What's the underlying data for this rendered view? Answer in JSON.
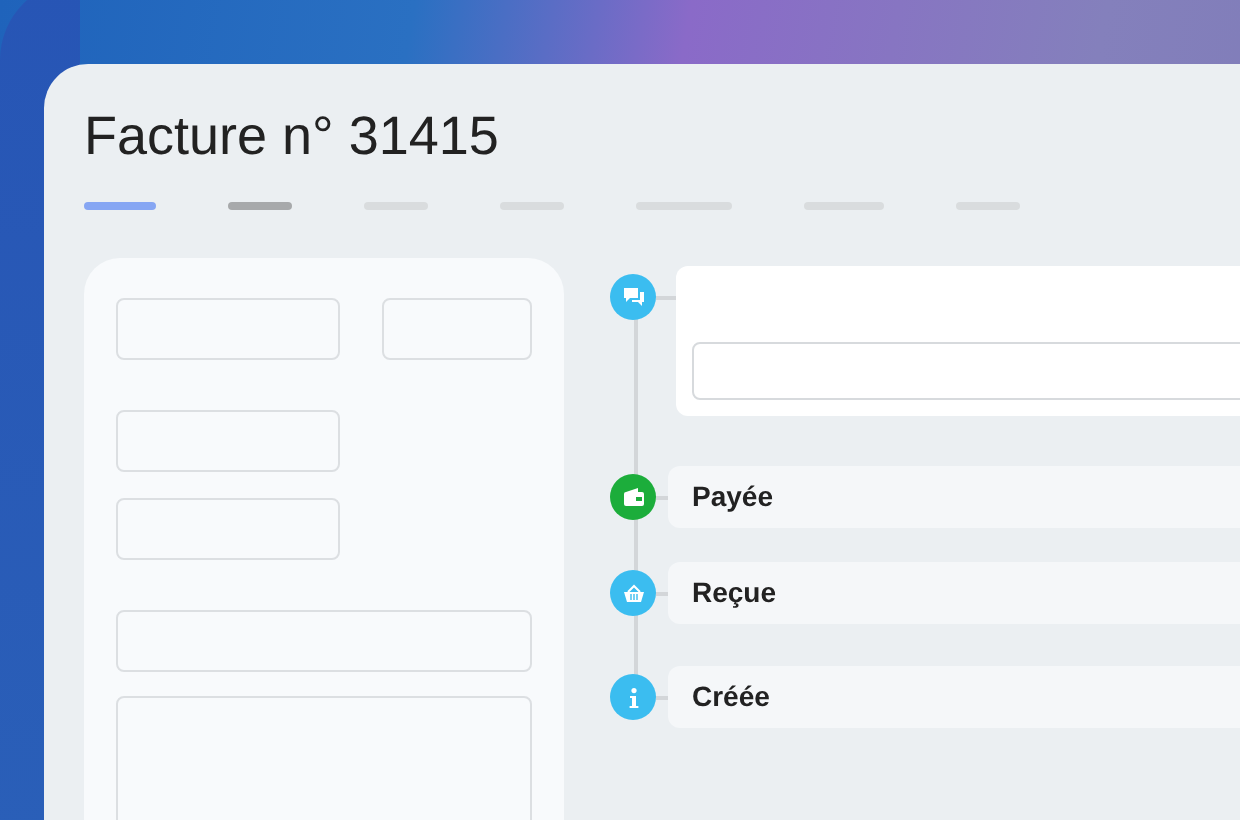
{
  "title": "Facture n° 31415",
  "tabs": [
    {
      "selected": true
    },
    {
      "selected": false,
      "visited": true
    },
    {
      "selected": false
    },
    {
      "selected": false
    },
    {
      "selected": false
    },
    {
      "selected": false
    },
    {
      "selected": false
    }
  ],
  "timeline": [
    {
      "kind": "comment",
      "color": "#3bbdf0"
    },
    {
      "kind": "status",
      "label": "Payée",
      "color": "#1cad3b"
    },
    {
      "kind": "status",
      "label": "Reçue",
      "color": "#3bbdf0"
    },
    {
      "kind": "status",
      "label": "Créée",
      "color": "#3bbdf0"
    }
  ]
}
